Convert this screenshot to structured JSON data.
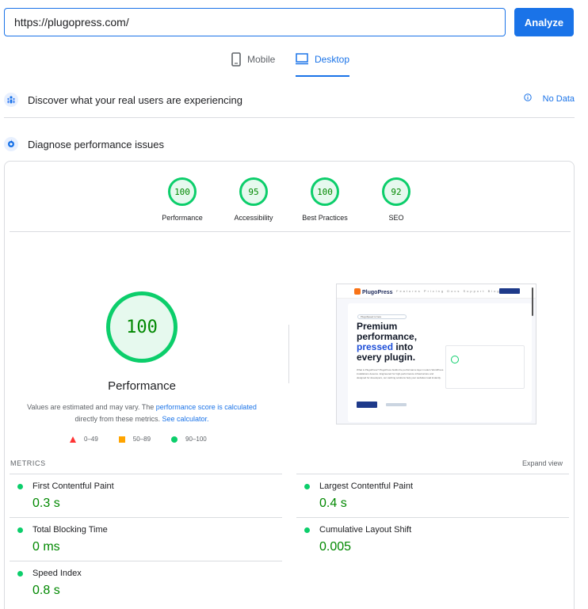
{
  "search": {
    "value": "https://plugopress.com/",
    "analyze_label": "Analyze"
  },
  "tabs": [
    {
      "label": "Mobile",
      "icon": "mobile-icon",
      "active": false
    },
    {
      "label": "Desktop",
      "icon": "desktop-icon",
      "active": true
    }
  ],
  "discover": {
    "title": "Discover what your real users are experiencing",
    "status_icon": "info-icon",
    "status": "No Data"
  },
  "diagnose": {
    "title": "Diagnose performance issues"
  },
  "scores": [
    {
      "value": "100",
      "label": "Performance"
    },
    {
      "value": "95",
      "label": "Accessibility"
    },
    {
      "value": "100",
      "label": "Best Practices"
    },
    {
      "value": "92",
      "label": "SEO"
    }
  ],
  "main_score": {
    "value": "100",
    "label": "Performance",
    "note_prefix": "Values are estimated and may vary. The ",
    "note_link1": "performance score is calculated",
    "note_middle": "directly from these metrics. ",
    "note_link2": "See calculator."
  },
  "legend": [
    {
      "shape": "triangle",
      "range": "0–49",
      "color": "#ff3333"
    },
    {
      "shape": "square",
      "range": "50–89",
      "color": "#ffa400"
    },
    {
      "shape": "circle",
      "range": "90–100",
      "color": "#0cce6b"
    }
  ],
  "screenshot": {
    "brand": "PlugoPress",
    "menu": "Features Pricing Docs Support Blog",
    "pill": "PlugoSpeed is here",
    "headline_1": "Premium",
    "headline_2": "performance,",
    "headline_3_accent": "pressed",
    "headline_3_rest": " into",
    "headline_4": "every plugin.",
    "body": "What is PlugoPress? PlugoPress builds the performance layer modern WordPress installations deserve. Engineered for high-performance infrastructure and designed for developers, our caching solutions help your websites load instantly."
  },
  "metrics": {
    "section_label": "METRICS",
    "expand_label": "Expand view",
    "items": [
      {
        "name": "First Contentful Paint",
        "value": "0.3 s"
      },
      {
        "name": "Largest Contentful Paint",
        "value": "0.4 s"
      },
      {
        "name": "Total Blocking Time",
        "value": "0 ms"
      },
      {
        "name": "Cumulative Layout Shift",
        "value": "0.005"
      },
      {
        "name": "Speed Index",
        "value": "0.8 s"
      }
    ]
  },
  "colors": {
    "accent": "#1a73e8",
    "pass": "#0cce6b",
    "pass_text": "#008800",
    "pass_bg": "#e6f9ee"
  }
}
